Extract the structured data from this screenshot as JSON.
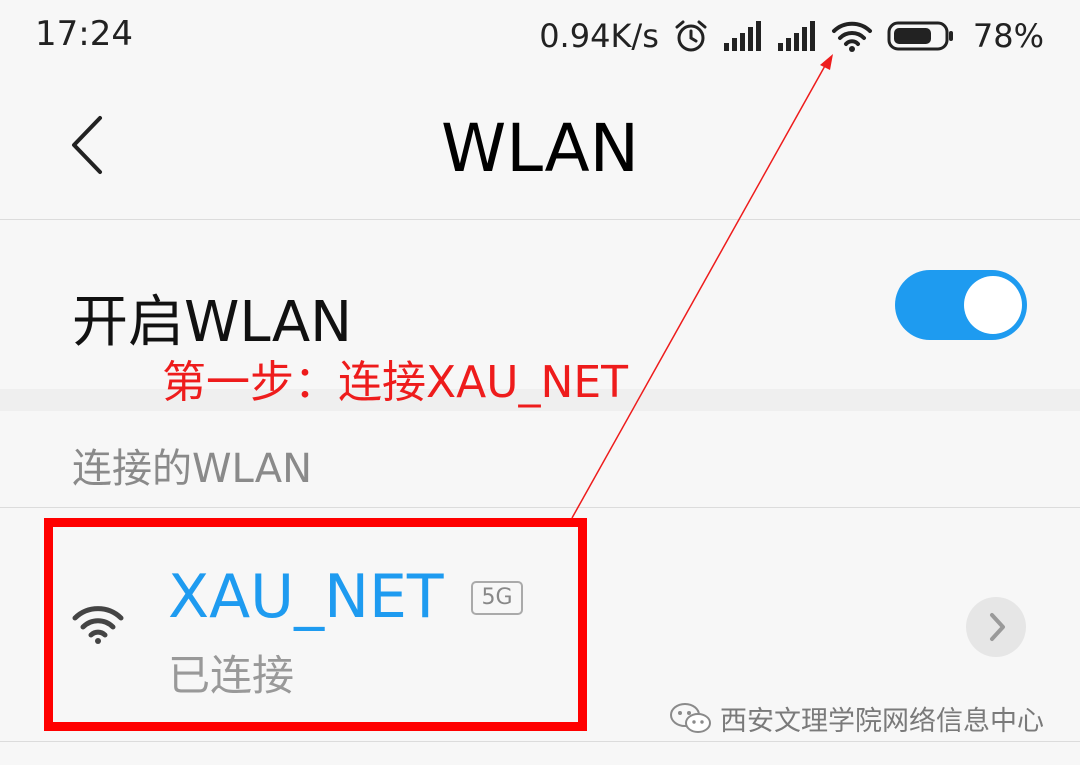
{
  "status_bar": {
    "time": "17:24",
    "net_speed": "0.94K/s",
    "battery_percent": "78%",
    "battery_level": 0.78,
    "icons": [
      "alarm-icon",
      "cell-signal-icon",
      "cell-signal-icon",
      "wifi-icon",
      "battery-icon"
    ]
  },
  "header": {
    "title": "WLAN",
    "back_icon": "chevron-left-icon"
  },
  "wlan_toggle": {
    "label": "开启WLAN",
    "enabled": true
  },
  "annotation": {
    "step_text": "第一步：连接XAU_NET",
    "color": "#ee1c1c"
  },
  "connected_section": {
    "header": "连接的WLAN",
    "network": {
      "name": "XAU_NET",
      "band": "5G",
      "status": "已连接",
      "icon": "wifi-icon",
      "detail_icon": "chevron-right-icon"
    }
  },
  "watermark": {
    "text": "西安文理学院网络信息中心",
    "icon": "wechat-icon"
  },
  "colors": {
    "accent": "#1e9bf0",
    "highlight": "#ff0000",
    "background": "#f7f7f7"
  }
}
